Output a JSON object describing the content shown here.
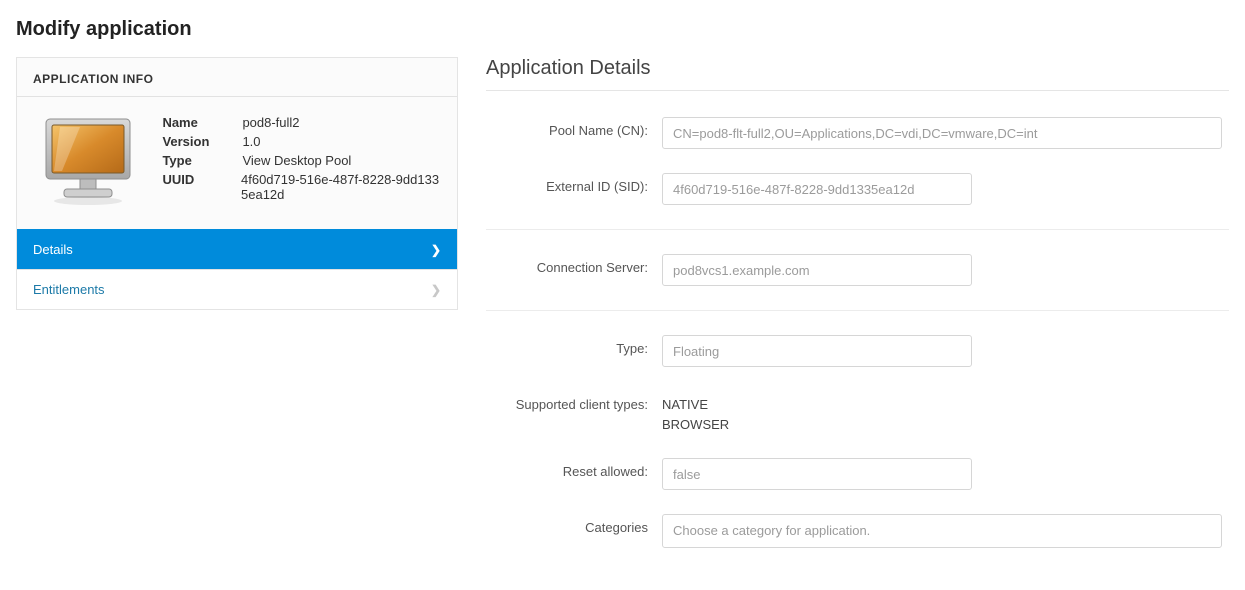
{
  "page_title": "Modify application",
  "info": {
    "header": "APPLICATION INFO",
    "name_label": "Name",
    "name_value": "pod8-full2",
    "version_label": "Version",
    "version_value": "1.0",
    "type_label": "Type",
    "type_value": "View Desktop Pool",
    "uuid_label": "UUID",
    "uuid_value": "4f60d719-516e-487f-8228-9dd1335ea12d"
  },
  "nav": {
    "details": "Details",
    "entitlements": "Entitlements"
  },
  "details": {
    "heading": "Application Details",
    "pool_name_label": "Pool Name (CN):",
    "pool_name_value": "CN=pod8-flt-full2,OU=Applications,DC=vdi,DC=vmware,DC=int",
    "external_id_label": "External ID (SID):",
    "external_id_value": "4f60d719-516e-487f-8228-9dd1335ea12d",
    "connection_server_label": "Connection Server:",
    "connection_server_value": "pod8vcs1.example.com",
    "type_label": "Type:",
    "type_value": "Floating",
    "supported_clients_label": "Supported client types:",
    "supported_clients_value": "NATIVE\nBROWSER",
    "reset_allowed_label": "Reset allowed:",
    "reset_allowed_value": "false",
    "categories_label": "Categories",
    "categories_placeholder": "Choose a category for application."
  }
}
